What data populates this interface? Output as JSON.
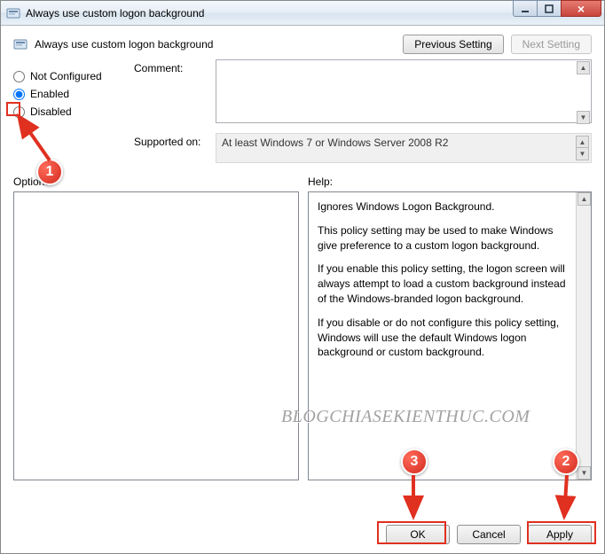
{
  "window": {
    "title": "Always use custom logon background"
  },
  "header": {
    "heading": "Always use custom logon background",
    "prev_btn": "Previous Setting",
    "next_btn": "Next Setting"
  },
  "radios": {
    "not_configured": "Not Configured",
    "enabled": "Enabled",
    "disabled": "Disabled",
    "selected": "enabled"
  },
  "fields": {
    "comment_label": "Comment:",
    "comment_value": "",
    "supported_label": "Supported on:",
    "supported_value": "At least Windows 7 or Windows Server 2008 R2"
  },
  "labels": {
    "options": "Options:",
    "help": "Help:"
  },
  "help": {
    "p1": "Ignores Windows Logon Background.",
    "p2": "This policy setting may be used to make Windows give preference to a custom logon background.",
    "p3": "If you enable this policy setting, the logon screen will always attempt to load a custom background instead of the Windows-branded logon background.",
    "p4": "If you disable or do not configure this policy setting, Windows will use the default Windows logon background or custom background."
  },
  "buttons": {
    "ok": "OK",
    "cancel": "Cancel",
    "apply": "Apply"
  },
  "annotations": {
    "n1": "1",
    "n2": "2",
    "n3": "3",
    "watermark": "BLOGCHIASEKIENTHUC.COM"
  }
}
